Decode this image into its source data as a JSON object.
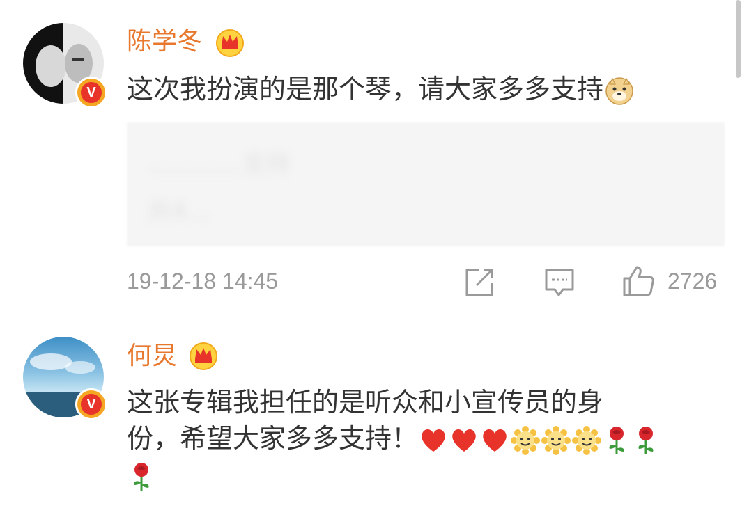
{
  "comments": [
    {
      "username": "陈学冬",
      "text": "这次我扮演的是那个琴，请大家多多支持",
      "text_emoji": "doge-emoji",
      "quote": {
        "line1": "…………支持",
        "line2": "共4…"
      },
      "time": "19-12-18 14:45",
      "likes": "2726"
    },
    {
      "username": "何炅",
      "text_line1": "这张专辑我担任的是听众和小宣传员的身",
      "text_line2": "份，希望大家多多支持！",
      "emojis": [
        "heart-emoji",
        "heart-emoji",
        "heart-emoji",
        "sun-emoji",
        "sun-emoji",
        "sun-emoji",
        "rose-emoji",
        "rose-emoji",
        "rose-emoji"
      ]
    }
  ],
  "colors": {
    "username": "#e8782e",
    "text": "#333333",
    "meta": "#9a9a9a",
    "badge_orange": "#f5a623",
    "badge_red": "#e7332a"
  }
}
